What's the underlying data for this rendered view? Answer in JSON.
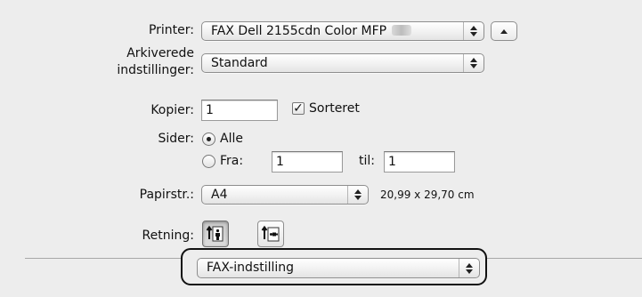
{
  "printer": {
    "label": "Printer:",
    "value": "FAX Dell 2155cdn Color MFP"
  },
  "presets": {
    "label_line1": "Arkiverede",
    "label_line2": "indstillinger:",
    "value": "Standard"
  },
  "copies": {
    "label": "Kopier:",
    "value": "1",
    "collated_label": "Sorteret",
    "collated_checked": true
  },
  "pages": {
    "label": "Sider:",
    "all_label": "Alle",
    "from_label": "Fra:",
    "from_value": "1",
    "to_label": "til:",
    "to_value": "1",
    "selected": "all"
  },
  "paper_size": {
    "label": "Papirstr.:",
    "value": "A4",
    "dimensions": "20,99 x 29,70 cm"
  },
  "orientation": {
    "label": "Retning:",
    "options": [
      "portrait",
      "landscape"
    ],
    "selected": "portrait"
  },
  "section_popup": {
    "value": "FAX-indstilling"
  }
}
